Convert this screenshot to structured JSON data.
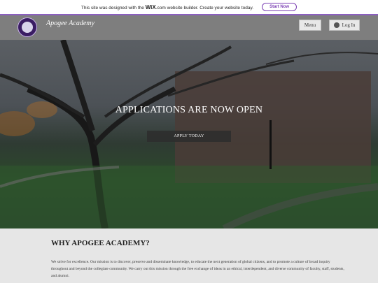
{
  "wix_bar": {
    "message": "This site was designed with the",
    "brand": "WiX",
    "suffix": ".com website builder. Create your website today.",
    "cta": "Start Now"
  },
  "header": {
    "site_name": "Apogee Academy",
    "menu_label": "Menu",
    "login_label": "Log In"
  },
  "hero": {
    "title": "APPLICATIONS ARE NOW OPEN",
    "apply_label": "APPLY TODAY"
  },
  "about": {
    "heading": "WHY APOGEE ACADEMY?",
    "body": "We strive for excellence. Our mission is to discover, preserve and disseminate knowledge, to educate the next generation of global citizens, and to promote a culture of broad inquiry throughout and beyond the collegiate community. We carry out this mission through the free exchange of ideas in an ethical, interdependent, and diverse community of faculty, staff, students, and alumni."
  },
  "colors": {
    "accent": "#7a3fb3",
    "header_bg": "#787878",
    "logo_bg": "#3a1c63"
  }
}
